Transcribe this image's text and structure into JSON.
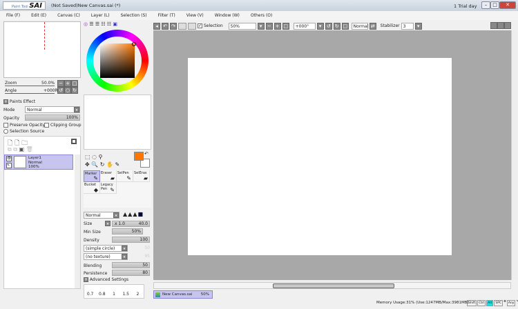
{
  "window": {
    "title": "(Not Saved)New Canvas.sai (*)",
    "trial": "1 Trial day",
    "logo_text": "PaintTool SAI"
  },
  "menu": [
    "File (F)",
    "Edit (E)",
    "Canvas (C)",
    "Layer (L)",
    "Selection (S)",
    "Filter (T)",
    "View (V)",
    "Window (W)",
    "Others (O)"
  ],
  "toolbar": {
    "selection_label": "Selection",
    "zoom": "50%",
    "angle": "+000°",
    "mode": "Normal",
    "stabilizer_label": "Stabilizer",
    "stabilizer": "3"
  },
  "navigator": {
    "zoom_label": "Zoom",
    "zoom": "50.0%",
    "angle_label": "Angle",
    "angle": "+000R"
  },
  "layer_panel": {
    "paints_effect": "Paints Effect",
    "mode_label": "Mode",
    "mode": "Normal",
    "opacity_label": "Opacity",
    "opacity": "100%",
    "preserve_opacity": "Preserve Opacity",
    "clipping_group": "Clipping Group",
    "selection_source": "Selection Source",
    "layers": [
      {
        "name": "Layer1",
        "mode": "Normal",
        "opacity": "100%"
      }
    ]
  },
  "colors": {
    "primary": "#ff7700",
    "secondary": "#ffffff"
  },
  "tools": [
    {
      "name": "Marker"
    },
    {
      "name": "Eraser"
    },
    {
      "name": "SelPen"
    },
    {
      "name": "SelEras"
    },
    {
      "name": "Bucket"
    },
    {
      "name": "Legacy Pen"
    }
  ],
  "brush": {
    "mode": "Normal",
    "size_label": "Size",
    "size_mult": "x 1.0",
    "size": "40.0",
    "min_size_label": "Min Size",
    "min_size": "50%",
    "density_label": "Density",
    "density": "100",
    "shape": "(simple circle)",
    "shape_val": "50",
    "texture": "(no texture)",
    "texture_val": "95",
    "blending_label": "Blending",
    "blending": "50",
    "persistence_label": "Persistence",
    "persistence": "80",
    "advanced": "Advanced Settings",
    "presets": [
      "0.7",
      "0.8",
      "1",
      "1.5",
      "2"
    ]
  },
  "tabs": [
    {
      "name": "New Canvas.sai",
      "zoom": "50%"
    }
  ],
  "status": {
    "memory": "Memory Usage:31% (Use:1247MB/Max:3981MB)",
    "keys": [
      "Shift",
      "Ctrl",
      "Alt",
      "SPC",
      "Any"
    ]
  }
}
